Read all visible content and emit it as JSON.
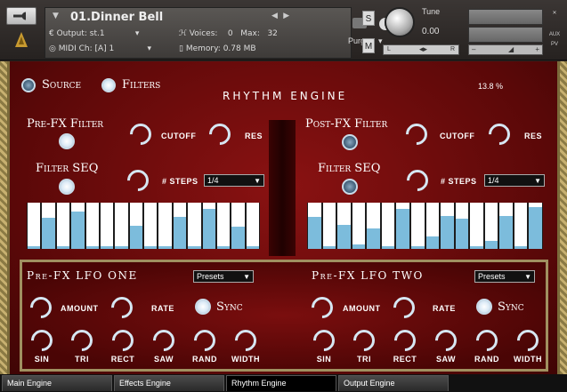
{
  "header": {
    "instrument": "01.Dinner Bell",
    "output_label": "Output:",
    "output": "st.1",
    "voices_label": "Voices:",
    "voices": "0",
    "max_label": "Max:",
    "max": "32",
    "midi_label": "MIDI Ch:",
    "midi": "[A]  1",
    "memory_label": "Memory:",
    "memory": "0.78 MB",
    "purge": "Purge",
    "s": "S",
    "m": "M",
    "tune_label": "Tune",
    "tune_value": "0.00",
    "aux": "AUX",
    "pv": "PV",
    "l": "L",
    "r": "R"
  },
  "top": {
    "source": "Source",
    "filters": "Filters",
    "engine_title": "RHYTHM ENGINE",
    "percent": "13.8 %"
  },
  "pre": {
    "title": "Pre-FX Filter",
    "cutoff": "CUTOFF",
    "res": "RES",
    "seq": "Filter SEQ",
    "steps": "# STEPS",
    "steps_value": "1/4"
  },
  "post": {
    "title": "Post-FX Filter",
    "cutoff": "CUTOFF",
    "res": "RES",
    "seq": "Filter SEQ",
    "steps": "# STEPS",
    "steps_value": "1/4"
  },
  "seq_left": [
    0.05,
    0.68,
    0.05,
    0.8,
    0.05,
    0.05,
    0.05,
    0.5,
    0.05,
    0.05,
    0.7,
    0.05,
    0.87,
    0.05,
    0.48,
    0.05
  ],
  "seq_right": [
    0.7,
    0.05,
    0.52,
    0.1,
    0.45,
    0.05,
    0.87,
    0.05,
    0.27,
    0.72,
    0.65,
    0.05,
    0.18,
    0.72,
    0.05,
    0.9
  ],
  "lfo1": {
    "title": "Pre-FX LFO ONE",
    "presets": "Presets",
    "amount": "AMOUNT",
    "rate": "RATE",
    "sync": "Sync",
    "waves": [
      "SIN",
      "TRI",
      "RECT",
      "SAW",
      "RAND",
      "WIDTH"
    ]
  },
  "lfo2": {
    "title": "Pre-FX LFO TWO",
    "presets": "Presets",
    "amount": "AMOUNT",
    "rate": "RATE",
    "sync": "Sync",
    "waves": [
      "SIN",
      "TRI",
      "RECT",
      "SAW",
      "RAND",
      "WIDTH"
    ]
  },
  "tabs": [
    "Main Engine",
    "Effects Engine",
    "Rhythm Engine",
    "Output Engine"
  ]
}
